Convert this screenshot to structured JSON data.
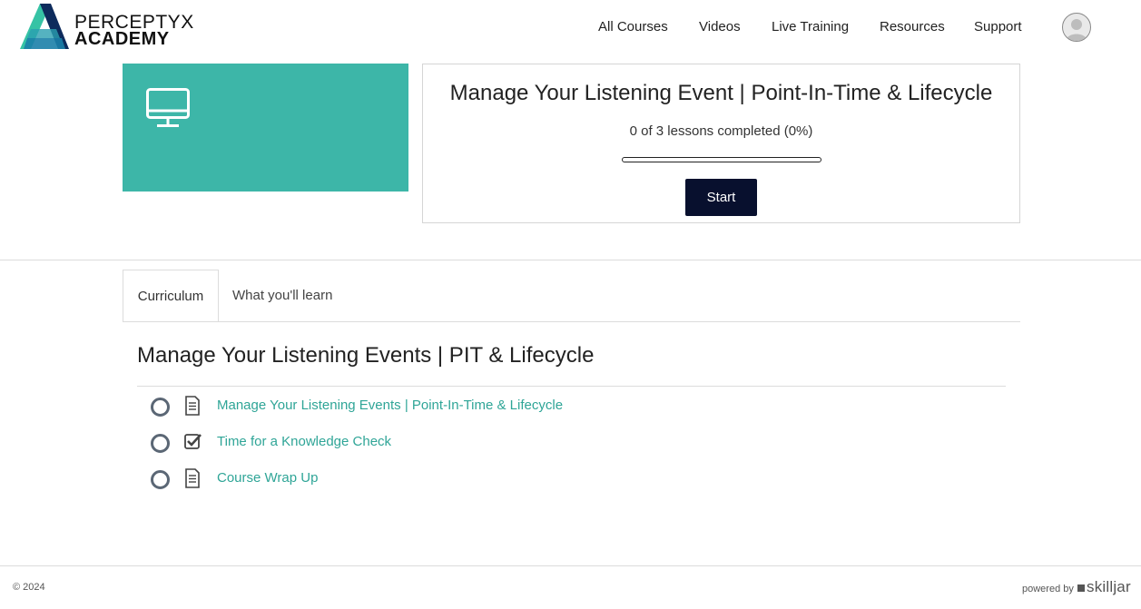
{
  "brand": {
    "line1": "PERCEPTYX",
    "line2": "ACADEMY",
    "colors": {
      "teal": "#3db6a8",
      "navy": "#08102e",
      "link": "#2fa597"
    }
  },
  "nav": {
    "items": [
      {
        "label": "All Courses"
      },
      {
        "label": "Videos"
      },
      {
        "label": "Live Training"
      },
      {
        "label": "Resources"
      },
      {
        "label": "Support"
      }
    ],
    "avatar_icon": "user-avatar-icon"
  },
  "course": {
    "image_icon": "monitor-icon",
    "title": "Manage Your Listening Event | Point-In-Time & Lifecycle",
    "progress_text": "0 of 3 lessons completed (0%)",
    "progress_percent": 0,
    "start_label": "Start"
  },
  "tabs": [
    {
      "label": "Curriculum",
      "active": true
    },
    {
      "label": "What you'll learn",
      "active": false
    }
  ],
  "curriculum": {
    "section_title": "Manage Your Listening Events | PIT & Lifecycle",
    "lessons": [
      {
        "name": "Manage Your Listening Events | Point-In-Time & Lifecycle",
        "type_icon": "document-icon",
        "completed": false
      },
      {
        "name": "Time for a Knowledge Check",
        "type_icon": "checkbox-icon",
        "completed": false
      },
      {
        "name": "Course Wrap Up",
        "type_icon": "document-icon",
        "completed": false
      }
    ]
  },
  "footer": {
    "copyright": "© 2024",
    "powered_by": "powered by",
    "provider": "skilljar"
  }
}
